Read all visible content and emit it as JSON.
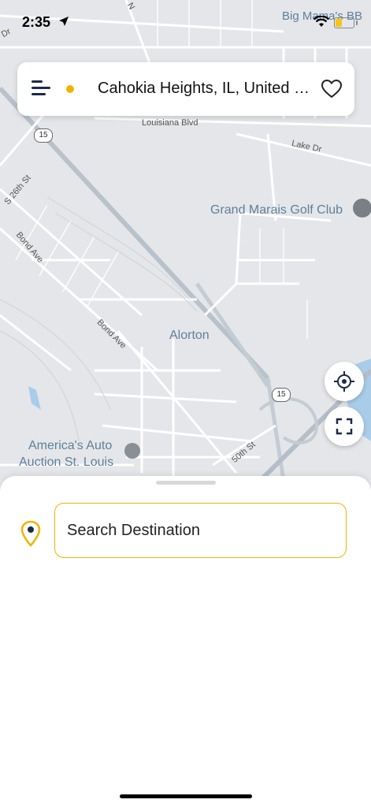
{
  "status_bar": {
    "time": "2:35"
  },
  "top_bar": {
    "location": "Cahokia Heights, IL, United States"
  },
  "map": {
    "labels": {
      "golf": "Grand Marais Golf Club",
      "alorton": "Alorton",
      "auction_line1": "America's Auto",
      "auction_line2": "Auction St. Louis",
      "big_mamas": "Big Mama's BB"
    },
    "roads": {
      "louisiana": "Louisiana Blvd",
      "lake": "Lake Dr",
      "s26th": "S 26th St",
      "bond1": "Bond Ave",
      "bond2": "Bond Ave",
      "fiftieth": "50th St",
      "dr": "Dr",
      "n": "N"
    },
    "shields": {
      "route_a": "15",
      "route_b": "15",
      "route_c": "15"
    }
  },
  "search": {
    "placeholder": "Search Destination"
  },
  "colors": {
    "accent": "#f0b400",
    "menu": "#1d2a44",
    "water": "#a9cde8"
  }
}
